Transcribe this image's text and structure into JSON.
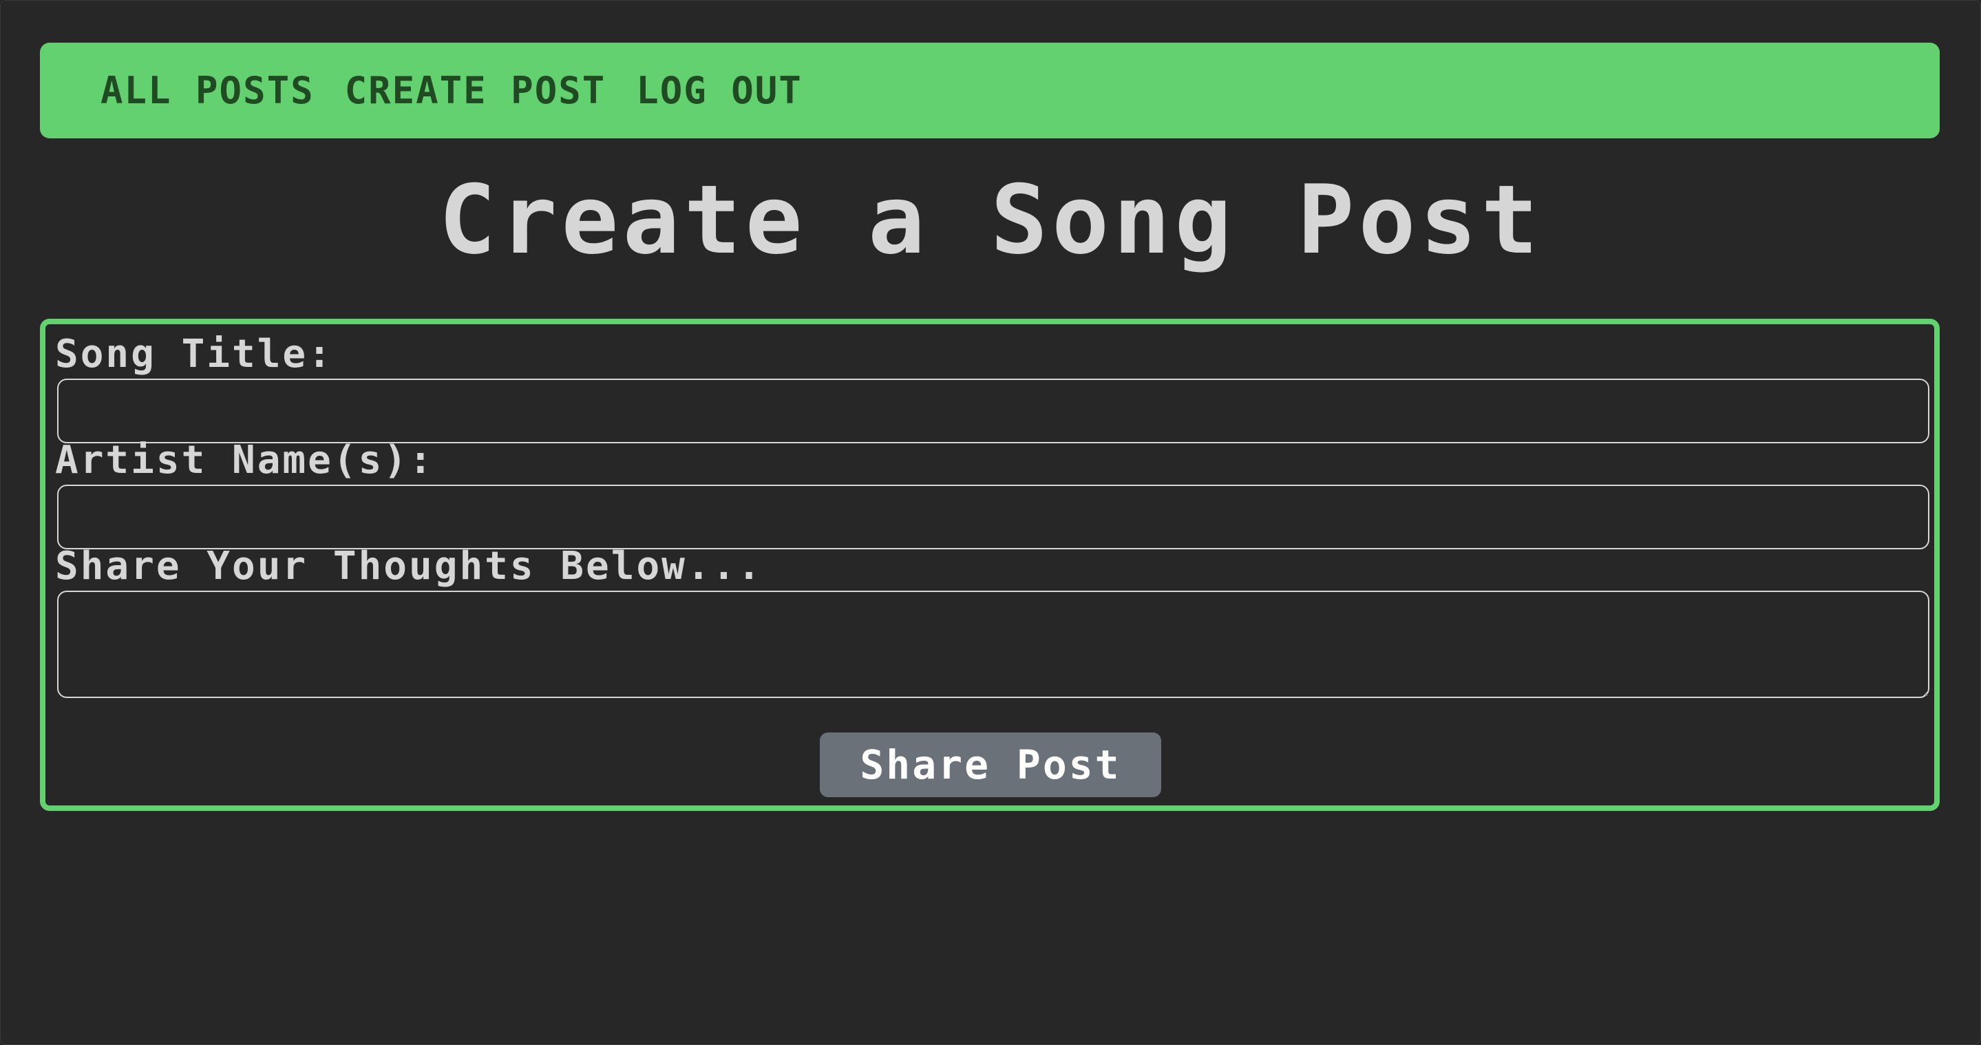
{
  "nav": {
    "links": [
      {
        "label": "ALL POSTS"
      },
      {
        "label": "CREATE POST"
      },
      {
        "label": "LOG OUT"
      }
    ]
  },
  "page": {
    "title": "Create a Song Post"
  },
  "form": {
    "song_title_label": "Song Title:",
    "song_title_value": "",
    "artist_label": "Artist Name(s):",
    "artist_value": "",
    "thoughts_label": "Share Your Thoughts Below...",
    "thoughts_value": "",
    "submit_label": "Share Post"
  },
  "colors": {
    "background": "#272727",
    "accent_green": "#64d170",
    "nav_text": "#1f4a22",
    "text": "#d6d6d6",
    "button": "#6b7178"
  }
}
